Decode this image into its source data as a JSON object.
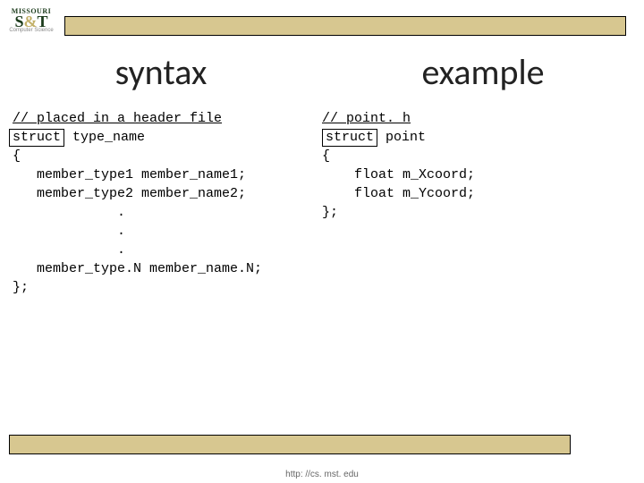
{
  "logo": {
    "top": "MISSOURI",
    "main_s": "S",
    "main_amp": "&",
    "main_t": "T",
    "sub": "Computer Science"
  },
  "headings": {
    "left": "syntax",
    "right": "example"
  },
  "syntax": {
    "comment": "// placed in a header file",
    "keyword": "struct",
    "typename": "type_name",
    "open": "{",
    "m1": "   member_type1 member_name1;",
    "m2": "   member_type2 member_name2;",
    "dot": "             .",
    "mN": "   member_type.N member_name.N;",
    "close": "};"
  },
  "example": {
    "comment": "// point. h",
    "keyword": "struct",
    "typename": "point",
    "open": "{",
    "f1": "    float m_Xcoord;",
    "f2": "    float m_Ycoord;",
    "close": "};"
  },
  "footer": "http: //cs. mst. edu"
}
